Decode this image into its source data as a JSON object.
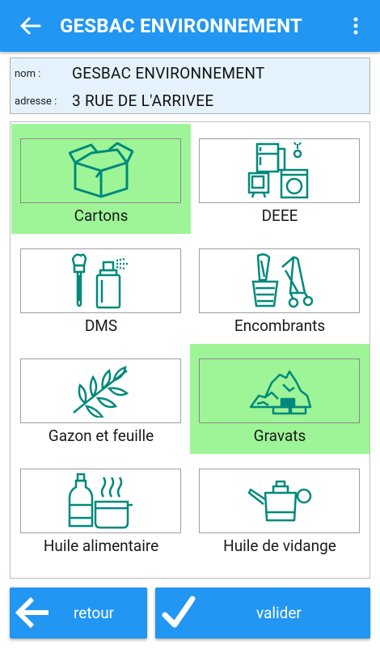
{
  "appbar": {
    "title": "GESBAC ENVIRONNEMENT",
    "back_icon": "arrow-left-icon",
    "menu_icon": "more-vert-icon",
    "color": "#2196f3"
  },
  "info": {
    "name_label": "nom :",
    "name_value": "GESBAC ENVIRONNEMENT",
    "address_label": "adresse :",
    "address_value": "3 RUE DE L'ARRIVEE",
    "background": "#e3f2fd"
  },
  "categories": [
    {
      "label": "Cartons",
      "icon": "cardboard-box-icon",
      "selected": true
    },
    {
      "label": "DEEE",
      "icon": "electronic-appliances-icon",
      "selected": false
    },
    {
      "label": "DMS",
      "icon": "paintbrush-spray-can-icon",
      "selected": false
    },
    {
      "label": "Encombrants",
      "icon": "bulky-items-icon",
      "selected": false
    },
    {
      "label": "Gazon et feuille",
      "icon": "leaf-branch-icon",
      "selected": false
    },
    {
      "label": "Gravats",
      "icon": "rubble-icon",
      "selected": true
    },
    {
      "label": "Huile alimentaire",
      "icon": "oil-bottle-pot-icon",
      "selected": false
    },
    {
      "label": "Huile de vidange",
      "icon": "oil-can-icon",
      "selected": false
    }
  ],
  "colors": {
    "selected": "#9ef597",
    "icon": "#00897b",
    "button": "#2196f3"
  },
  "buttons": {
    "back_label": "retour",
    "back_icon": "arrow-left-icon",
    "confirm_label": "valider",
    "confirm_icon": "checkmark-icon"
  }
}
